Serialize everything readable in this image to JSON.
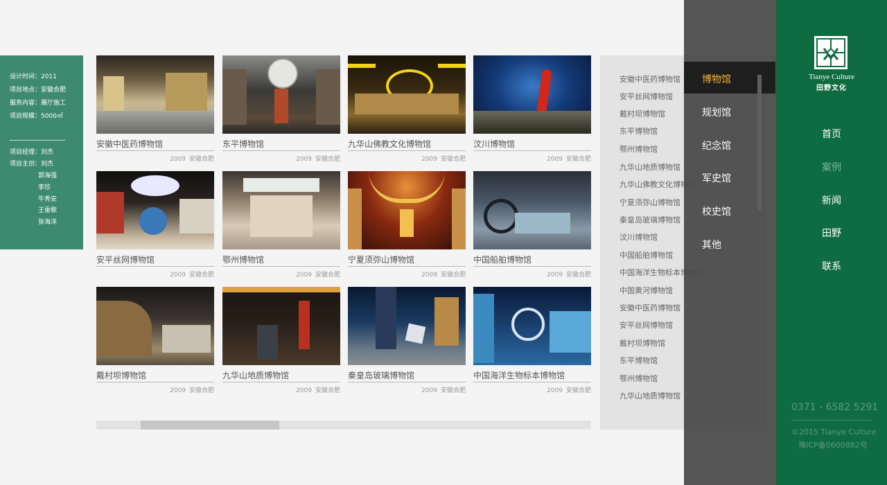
{
  "info": {
    "rows": [
      "设计时间：2011",
      "项目地点：安徽合肥",
      "服务内容：展厅施工",
      "项目规模：5000㎡"
    ],
    "team": [
      "项目经理：刘杰",
      "项目主创：刘杰",
      "郭海强",
      "李珍",
      "牛秀安",
      "王雷歌",
      "张海洋"
    ]
  },
  "cards": [
    {
      "title": "安徽中医药博物馆",
      "year": "2009",
      "loc": "安徽合肥"
    },
    {
      "title": "东平博物馆",
      "year": "2009",
      "loc": "安徽合肥"
    },
    {
      "title": "九华山佛教文化博物馆",
      "year": "2009",
      "loc": "安徽合肥"
    },
    {
      "title": "汶川博物馆",
      "year": "2009",
      "loc": "安徽合肥"
    },
    {
      "title": "安平丝网博物馆",
      "year": "2009",
      "loc": "安徽合肥"
    },
    {
      "title": "鄂州博物馆",
      "year": "2009",
      "loc": "安徽合肥"
    },
    {
      "title": "宁夏须弥山博物馆",
      "year": "2009",
      "loc": "安徽合肥"
    },
    {
      "title": "中国船舶博物馆",
      "year": "2009",
      "loc": "安徽合肥"
    },
    {
      "title": "戴村坝博物馆",
      "year": "2009",
      "loc": "安徽合肥"
    },
    {
      "title": "九华山地质博物馆",
      "year": "2009",
      "loc": "安徽合肥"
    },
    {
      "title": "秦皇岛玻璃博物馆",
      "year": "2009",
      "loc": "安徽合肥"
    },
    {
      "title": "中国海洋生物标本博物馆",
      "year": "2009",
      "loc": "安徽合肥"
    }
  ],
  "museum_list": [
    "安徽中医药博物馆",
    "安平丝网博物馆",
    "戴村坝博物馆",
    "东平博物馆",
    "鄂州博物馆",
    "九华山地质博物馆",
    "九华山佛教文化博物馆",
    "宁夏须弥山博物馆",
    "秦皇岛玻璃博物馆",
    "汶川博物馆",
    "中国船舶博物馆",
    "中国海洋生物标本博物馆",
    "中国黄河博物馆",
    "安徽中医药博物馆",
    "安平丝网博物馆",
    "戴村坝博物馆",
    "东平博物馆",
    "鄂州博物馆",
    "九华山地质博物馆"
  ],
  "categories": [
    {
      "label": "博物馆",
      "active": true
    },
    {
      "label": "规划馆",
      "active": false
    },
    {
      "label": "纪念馆",
      "active": false
    },
    {
      "label": "军史馆",
      "active": false
    },
    {
      "label": "校史馆",
      "active": false
    },
    {
      "label": "其他",
      "active": false
    }
  ],
  "brand": {
    "en": "Tianye Culture",
    "cn": "田野文化",
    "logo_icon": "tianye-logo-icon"
  },
  "nav": [
    {
      "label": "首页",
      "active": false
    },
    {
      "label": "案例",
      "active": true
    },
    {
      "label": "新闻",
      "active": false
    },
    {
      "label": "田野",
      "active": false
    },
    {
      "label": "联系",
      "active": false
    }
  ],
  "footer": {
    "phone": "0371 - 6582 5291",
    "copyright": "©2015 Tianye Culture",
    "icp": "豫ICP备0600882号"
  },
  "colors": {
    "nav_green": "#0f6b40",
    "info_green": "#3d8a70",
    "active_category": "#f0b43a"
  },
  "scroll": {
    "position": 0.09,
    "visible_fraction": 0.28
  }
}
